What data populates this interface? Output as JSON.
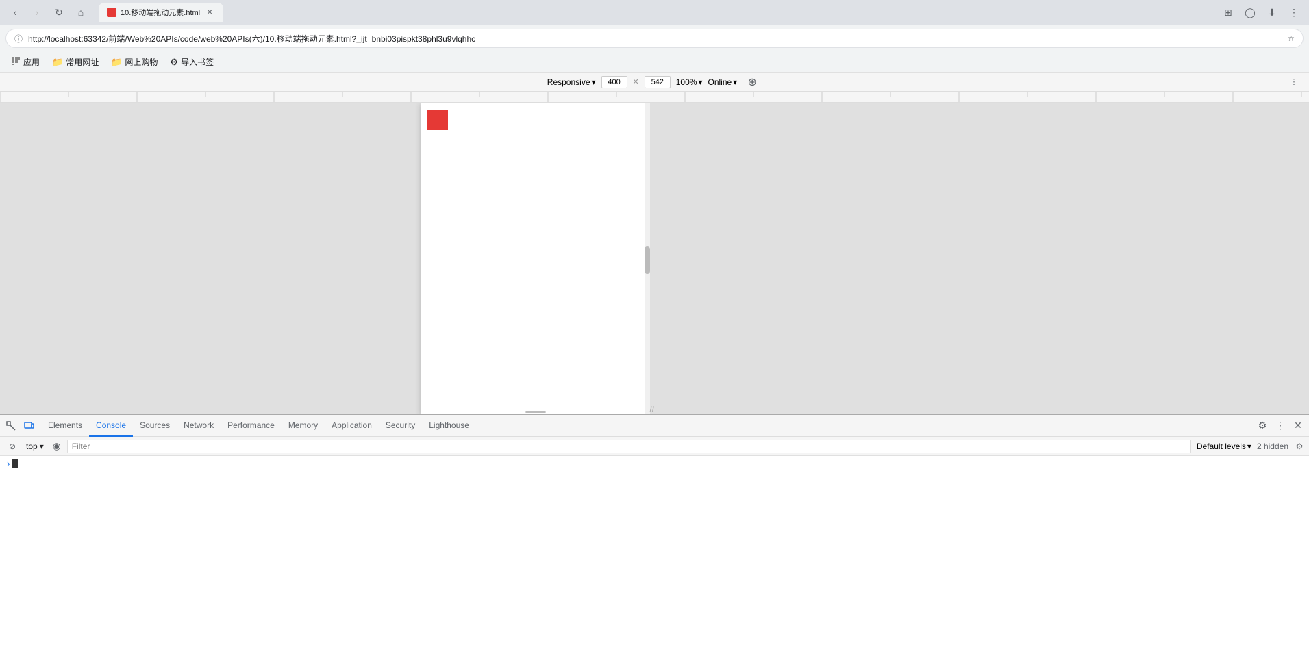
{
  "browser": {
    "url": "http://localhost:63342/前端/Web%20APIs/code/web%20APIs(六)/10.移动端拖动元素.html?_ijt=bnbi03pispkt38phl3u9vlqhhc",
    "tab_title": "10.移动端拖动元素.html",
    "back_disabled": false,
    "forward_disabled": true
  },
  "bookmarks": {
    "items": [
      {
        "label": "应用",
        "icon": "grid"
      },
      {
        "label": "常用网址",
        "icon": "folder"
      },
      {
        "label": "网上购物",
        "icon": "folder"
      },
      {
        "label": "导入书签",
        "icon": "gear"
      }
    ]
  },
  "devtools_responsive_bar": {
    "responsive_label": "Responsive",
    "width": "400",
    "height": "542",
    "zoom": "100%",
    "online": "Online"
  },
  "devtools": {
    "tabs": [
      {
        "label": "Elements",
        "id": "elements"
      },
      {
        "label": "Console",
        "id": "console",
        "active": true
      },
      {
        "label": "Sources",
        "id": "sources"
      },
      {
        "label": "Network",
        "id": "network"
      },
      {
        "label": "Performance",
        "id": "performance"
      },
      {
        "label": "Memory",
        "id": "memory"
      },
      {
        "label": "Application",
        "id": "application"
      },
      {
        "label": "Security",
        "id": "security"
      },
      {
        "label": "Lighthouse",
        "id": "lighthouse"
      }
    ],
    "console": {
      "context": "top",
      "filter_placeholder": "Filter",
      "default_levels": "Default levels",
      "hidden_count": "2 hidden"
    }
  },
  "icons": {
    "back": "‹",
    "forward": "›",
    "reload": "↻",
    "home": "⌂",
    "bookmark_star": "☆",
    "info": "ℹ",
    "extensions": "⊞",
    "profile": "◯",
    "download": "⬇",
    "menu": "⋮",
    "devtools_inspect": "⬚",
    "devtools_console_clear": "🚫",
    "devtools_settings": "⚙",
    "devtools_more": "⋮",
    "devtools_close": "✕",
    "eye": "◉",
    "dropdown_arrow": "▾"
  }
}
